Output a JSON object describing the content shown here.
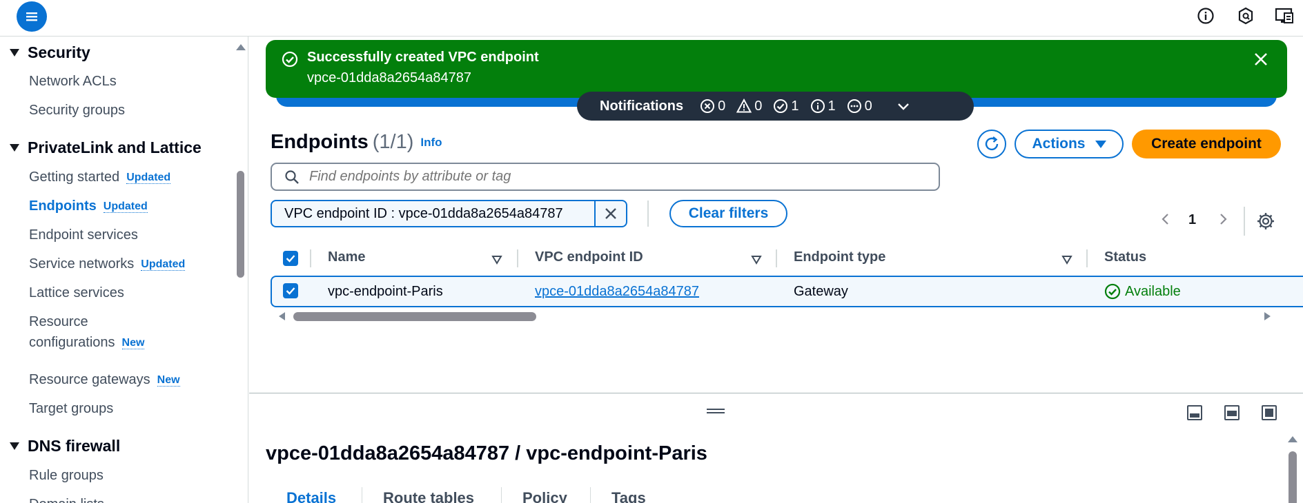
{
  "topbar": {
    "menu_icon": "hamburger-menu-icon",
    "icons": [
      "info-icon",
      "shield-icon",
      "feedback-icon"
    ]
  },
  "sidebar": {
    "sections": [
      {
        "title": "Security",
        "items": [
          {
            "label": "Network ACLs"
          },
          {
            "label": "Security groups"
          }
        ]
      },
      {
        "title": "PrivateLink and Lattice",
        "items": [
          {
            "label": "Getting started",
            "badge": "Updated"
          },
          {
            "label": "Endpoints",
            "badge": "Updated",
            "active": true
          },
          {
            "label": "Endpoint services"
          },
          {
            "label": "Service networks",
            "badge": "Updated"
          },
          {
            "label": "Lattice services"
          },
          {
            "label": "Resource",
            "label2": "configurations",
            "badge": "New"
          },
          {
            "label": "Resource gateways",
            "badge": "New"
          },
          {
            "label": "Target groups"
          }
        ]
      },
      {
        "title": "DNS firewall",
        "items": [
          {
            "label": "Rule groups"
          },
          {
            "label": "Domain lists"
          }
        ]
      }
    ]
  },
  "flash": {
    "title": "Successfully created VPC endpoint",
    "subtitle": "vpce-01dda8a2654a84787",
    "color": "#037f0c"
  },
  "notifications": {
    "label": "Notifications",
    "error": "0",
    "warning": "0",
    "success": "1",
    "info": "1",
    "progress": "0"
  },
  "endpoints": {
    "title": "Endpoints",
    "count": "(1/1)",
    "info": "Info",
    "actions_label": "Actions",
    "create_label": "Create endpoint",
    "search_placeholder": "Find endpoints by attribute or tag",
    "filter_token": "VPC endpoint ID : vpce-01dda8a2654a84787",
    "clear_filters": "Clear filters",
    "page": "1",
    "columns": [
      "Name",
      "VPC endpoint ID",
      "Endpoint type",
      "Status"
    ],
    "rows": [
      {
        "name": "vpc-endpoint-Paris",
        "id": "vpce-01dda8a2654a84787",
        "type": "Gateway",
        "status": "Available",
        "selected": true
      }
    ]
  },
  "details": {
    "title": "vpce-01dda8a2654a84787 / vpc-endpoint-Paris",
    "tabs": [
      "Details",
      "Route tables",
      "Policy",
      "Tags"
    ],
    "active_tab": "Details"
  },
  "colors": {
    "accent": "#0972d3",
    "primary_button": "#ff9900",
    "success": "#037f0c",
    "notification_bar": "#232f3e"
  }
}
